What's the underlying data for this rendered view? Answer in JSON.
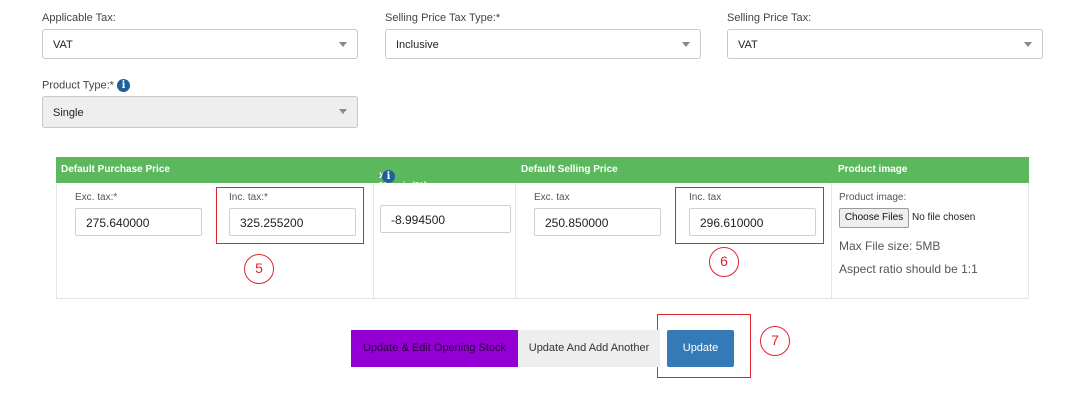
{
  "tax": {
    "applicable_label": "Applicable Tax:",
    "applicable_value": "VAT",
    "sp_type_label": "Selling Price Tax Type:*",
    "sp_type_value": "Inclusive",
    "sp_tax_label": "Selling Price Tax:",
    "sp_tax_value": "VAT"
  },
  "product_type": {
    "label": "Product Type:*",
    "value": "Single"
  },
  "table": {
    "headers": {
      "purchase": "Default Purchase Price",
      "margin": "x Margin(%)",
      "selling": "Default Selling Price",
      "image": "Product image"
    },
    "purchase": {
      "exc_label": "Exc. tax:*",
      "exc_value": "275.640000",
      "inc_label": "Inc. tax:*",
      "inc_value": "325.255200"
    },
    "margin_value": "-8.994500",
    "selling": {
      "exc_label": "Exc. tax",
      "exc_value": "250.850000",
      "inc_label": "Inc. tax",
      "inc_value": "296.610000"
    },
    "image": {
      "label": "Product image:",
      "choose_button": "Choose Files",
      "no_file": "No file chosen",
      "max_size": "Max File size: 5MB",
      "aspect": "Aspect ratio should be 1:1"
    }
  },
  "annotations": {
    "five": "5",
    "six": "6",
    "seven": "7"
  },
  "buttons": {
    "update_edit_stock": "Update & Edit Opening Stock",
    "update_add_another": "Update And Add Another",
    "update": "Update"
  },
  "colors": {
    "header_green": "#5cb85c",
    "purple": "#9400d3",
    "blue": "#337ab7",
    "annotation_red": "#e0242f"
  }
}
